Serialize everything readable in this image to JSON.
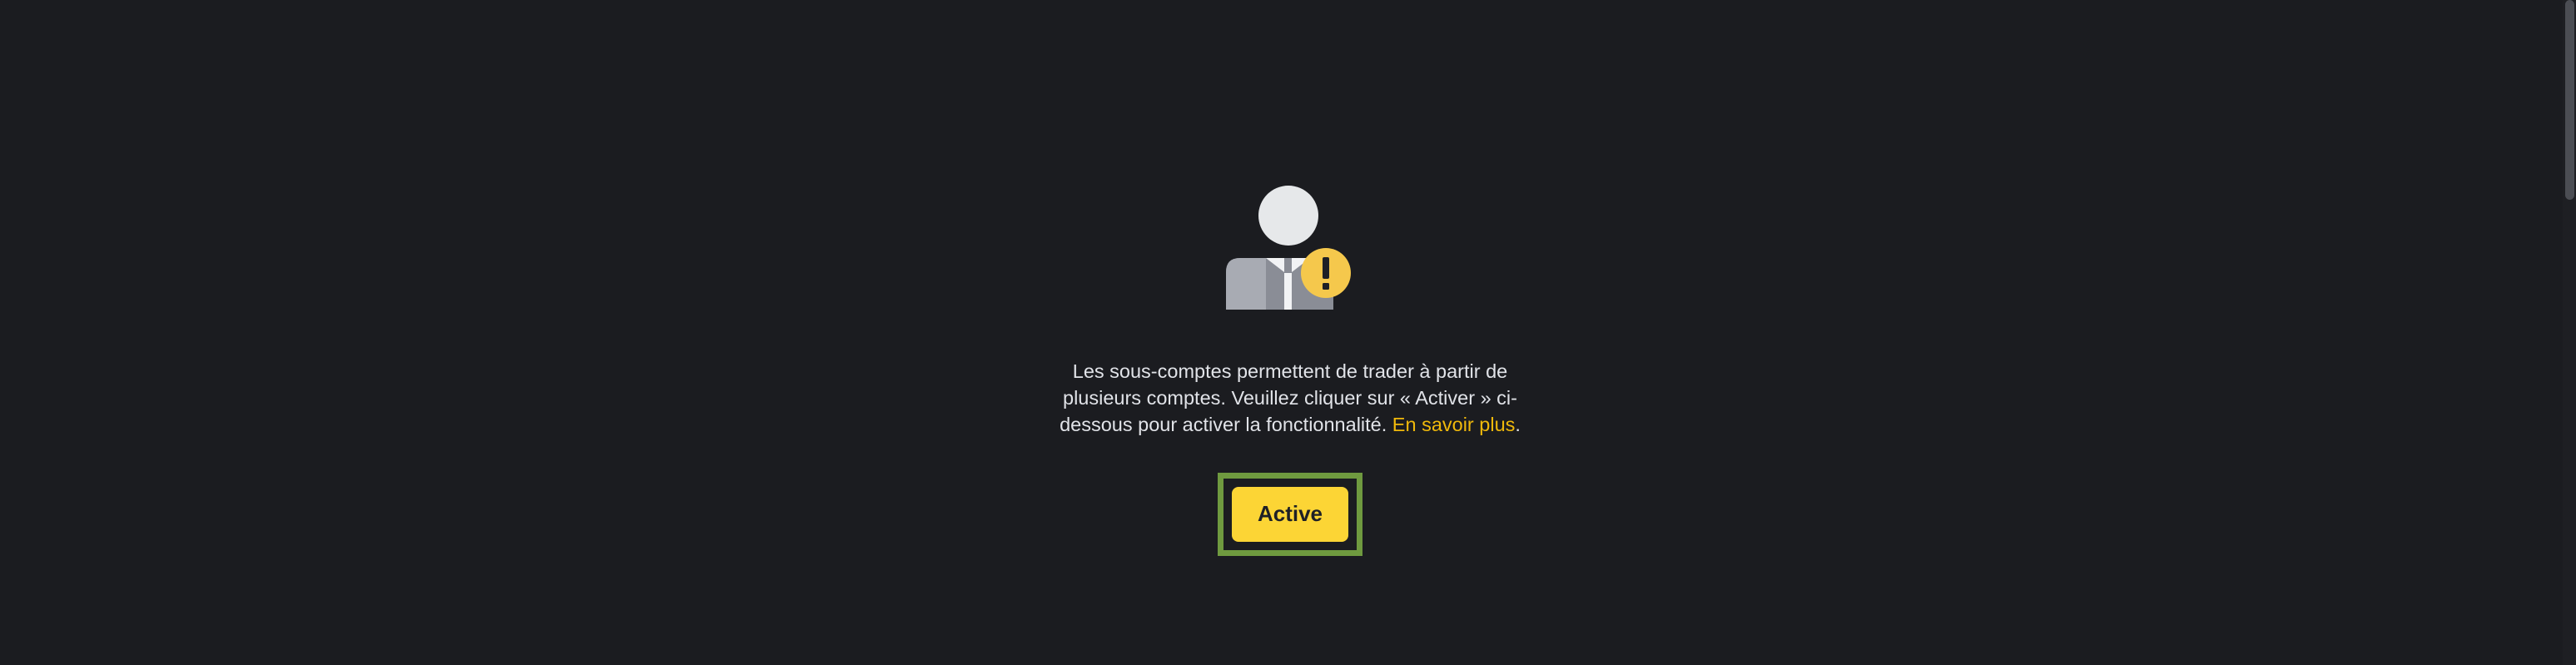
{
  "empty_state": {
    "illustration_icon": "user-warning-icon",
    "message": "Les sous-comptes permettent de trader à partir de plusieurs comptes. Veuillez cliquer sur « Activer » ci-dessous pour activer la fonctionnalité.",
    "learn_more_label": "En savoir plus",
    "trailing_punctuation": ".",
    "activate_button_label": "Active"
  },
  "colors": {
    "background": "#1b1c20",
    "accent": "#fcd535",
    "link": "#f0b90b",
    "text": "#e1e3e8",
    "highlight_frame": "#6f9a3f"
  }
}
